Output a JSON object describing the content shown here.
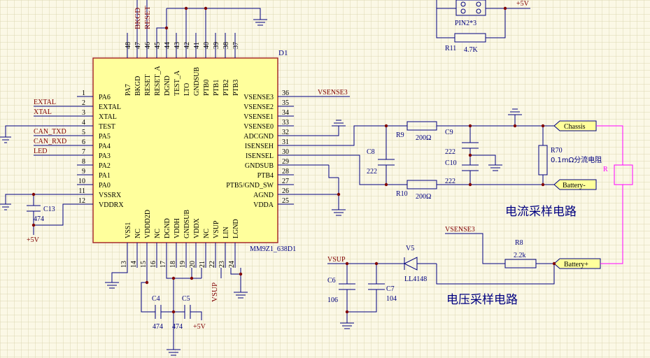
{
  "colors": {
    "background": "#fbf8e6",
    "grid": "#ddd7b2",
    "wire": "#000080",
    "chip_fill": "#ffff9c",
    "chip_border": "#a52a2a",
    "pin_text": "#000000",
    "net_label": "#800000",
    "part_label": "#000080",
    "rule": "#ff00ff"
  },
  "chip": {
    "designator": "D1",
    "part_number": "MM9Z1_638D1"
  },
  "pins_left": [
    {
      "num": "1",
      "name": "PA6"
    },
    {
      "num": "2",
      "name": "EXTAL"
    },
    {
      "num": "3",
      "name": "XTAL"
    },
    {
      "num": "4",
      "name": "TEST"
    },
    {
      "num": "5",
      "name": "PA5"
    },
    {
      "num": "6",
      "name": "PA4"
    },
    {
      "num": "7",
      "name": "PA3"
    },
    {
      "num": "8",
      "name": "PA2"
    },
    {
      "num": "9",
      "name": "PA1"
    },
    {
      "num": "10",
      "name": "PA0"
    },
    {
      "num": "11",
      "name": "VSSRX"
    },
    {
      "num": "12",
      "name": "VDDRX"
    }
  ],
  "pins_right": [
    {
      "num": "36",
      "name": "VSENSE3"
    },
    {
      "num": "35",
      "name": "VSENSE2"
    },
    {
      "num": "34",
      "name": "VSENSE1"
    },
    {
      "num": "33",
      "name": "VSENSE0"
    },
    {
      "num": "32",
      "name": "ADCGND"
    },
    {
      "num": "31",
      "name": "ISENSEH"
    },
    {
      "num": "30",
      "name": "ISENSEL"
    },
    {
      "num": "29",
      "name": "GNDSUB"
    },
    {
      "num": "28",
      "name": "PTB4"
    },
    {
      "num": "27",
      "name": "PTB5/GND_SW"
    },
    {
      "num": "26",
      "name": "AGND"
    },
    {
      "num": "25",
      "name": "VDDA"
    }
  ],
  "pins_top": [
    {
      "num": "48",
      "name": "PA7"
    },
    {
      "num": "47",
      "name": "BKGD"
    },
    {
      "num": "46",
      "name": "RESET"
    },
    {
      "num": "45",
      "name": "RESET_A"
    },
    {
      "num": "44",
      "name": "DGND"
    },
    {
      "num": "43",
      "name": "TEST_A"
    },
    {
      "num": "42",
      "name": "LTO"
    },
    {
      "num": "41",
      "name": "GNDSUB"
    },
    {
      "num": "40",
      "name": "PTB0"
    },
    {
      "num": "39",
      "name": "PTB1"
    },
    {
      "num": "38",
      "name": "PTB2"
    },
    {
      "num": "37",
      "name": "PTB3"
    }
  ],
  "pins_bottom": [
    {
      "num": "13",
      "name": "VSS1"
    },
    {
      "num": "14",
      "name": "NC"
    },
    {
      "num": "15",
      "name": "VDDD2D"
    },
    {
      "num": "16",
      "name": "NC"
    },
    {
      "num": "17",
      "name": "DGND"
    },
    {
      "num": "18",
      "name": "VDDH"
    },
    {
      "num": "19",
      "name": "GNDSUB"
    },
    {
      "num": "20",
      "name": "VDDX"
    },
    {
      "num": "21",
      "name": "NC"
    },
    {
      "num": "22",
      "name": "VSUP"
    },
    {
      "num": "23",
      "name": "LIN"
    },
    {
      "num": "24",
      "name": "LGND"
    }
  ],
  "nets": {
    "extal": "EXTAL",
    "xtal": "XTAL",
    "can_txd": "CAN_TXD",
    "can_rxd": "CAN_RXD",
    "led": "LED",
    "bkgd": "BKGD",
    "reset": "RESET",
    "vsense3_pin": "VSENSE3",
    "vsense3_r8": "VSENSE3",
    "vsup_bottom": "VSUP",
    "vsup_v5": "VSUP",
    "plus5_c13": "+5V",
    "plus5_c5": "+5V",
    "plus5_header": "+5V"
  },
  "parts": {
    "c13": {
      "ref": "C13",
      "value": "474"
    },
    "c4": {
      "ref": "C4",
      "value": "474"
    },
    "c5": {
      "ref": "C5",
      "value": "474"
    },
    "c8": {
      "ref": "C8",
      "value": "222"
    },
    "c9": {
      "ref": "C9",
      "value": "222"
    },
    "c10": {
      "ref": "C10",
      "value": "222"
    },
    "c6": {
      "ref": "C6",
      "value": "106"
    },
    "c7": {
      "ref": "C7",
      "value": "104"
    },
    "r9": {
      "ref": "R9",
      "value": "200Ω"
    },
    "r10": {
      "ref": "R10",
      "value": "200Ω"
    },
    "r70": {
      "ref": "R70",
      "value": "0.1mΩ分流电阻"
    },
    "r8": {
      "ref": "R8",
      "value": "2.2k"
    },
    "r11": {
      "ref": "R11",
      "value": "4.7K"
    },
    "v5": {
      "ref": "V5",
      "value": "LL4148"
    },
    "header": {
      "value": "PIN2*3"
    }
  },
  "ports": {
    "chassis": "Chassis",
    "battery_minus": "Battery-",
    "battery_plus": "Battery+"
  },
  "rule_label": "R",
  "captions": {
    "current": "电流采样电路",
    "voltage": "电压采样电路"
  }
}
